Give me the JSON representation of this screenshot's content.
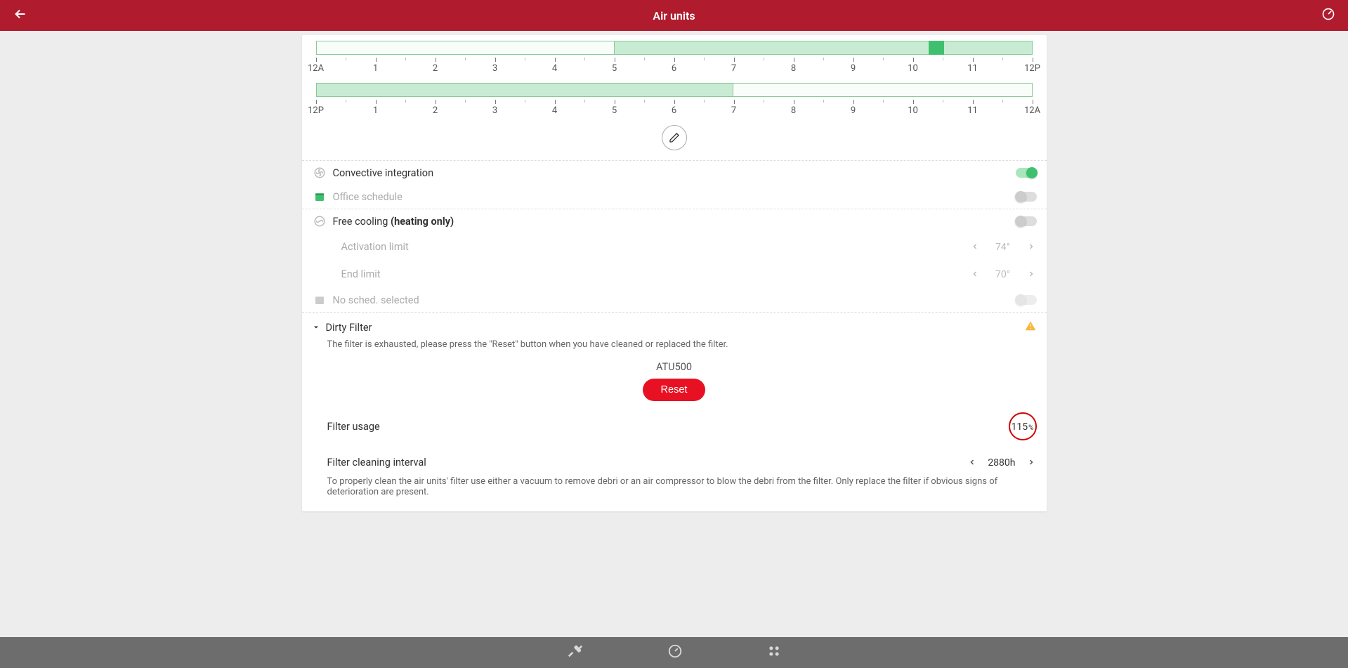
{
  "header": {
    "title": "Air units"
  },
  "timelines": {
    "top": {
      "labels": [
        "12A",
        "1",
        "2",
        "3",
        "4",
        "5",
        "6",
        "7",
        "8",
        "9",
        "10",
        "11",
        "12P"
      ],
      "fill_start_pct": 41.6,
      "fill_end_pct": 100,
      "marker_pct": 85.5
    },
    "bottom": {
      "labels": [
        "12P",
        "1",
        "2",
        "3",
        "4",
        "5",
        "6",
        "7",
        "8",
        "9",
        "10",
        "11",
        "12A"
      ],
      "fill_start_pct": 0,
      "fill_end_pct": 58.3
    }
  },
  "convective": {
    "label": "Convective integration",
    "on": true
  },
  "office_sched": {
    "label": "Office schedule",
    "on": false
  },
  "freecool": {
    "label": "Free cooling ",
    "label_bold": "(heating only)",
    "on": false,
    "activation": {
      "label": "Activation limit",
      "value": "74°"
    },
    "endlimit": {
      "label": "End limit",
      "value": "70°"
    },
    "nosched": {
      "label": "No sched. selected"
    }
  },
  "dirty": {
    "title": "Dirty Filter",
    "msg": "The filter is exhausted, please press the \"Reset\" button when you have cleaned or replaced the filter.",
    "unit": "ATU500",
    "reset": "Reset",
    "usage_label": "Filter usage",
    "usage_value": "115",
    "usage_unit": "%",
    "interval_label": "Filter cleaning interval",
    "interval_value": "2880h",
    "info": "To properly clean the air units' filter use either a vacuum to remove debri or an air compressor to blow the debri from the filter. Only replace the filter if obvious signs of deterioration are present."
  }
}
